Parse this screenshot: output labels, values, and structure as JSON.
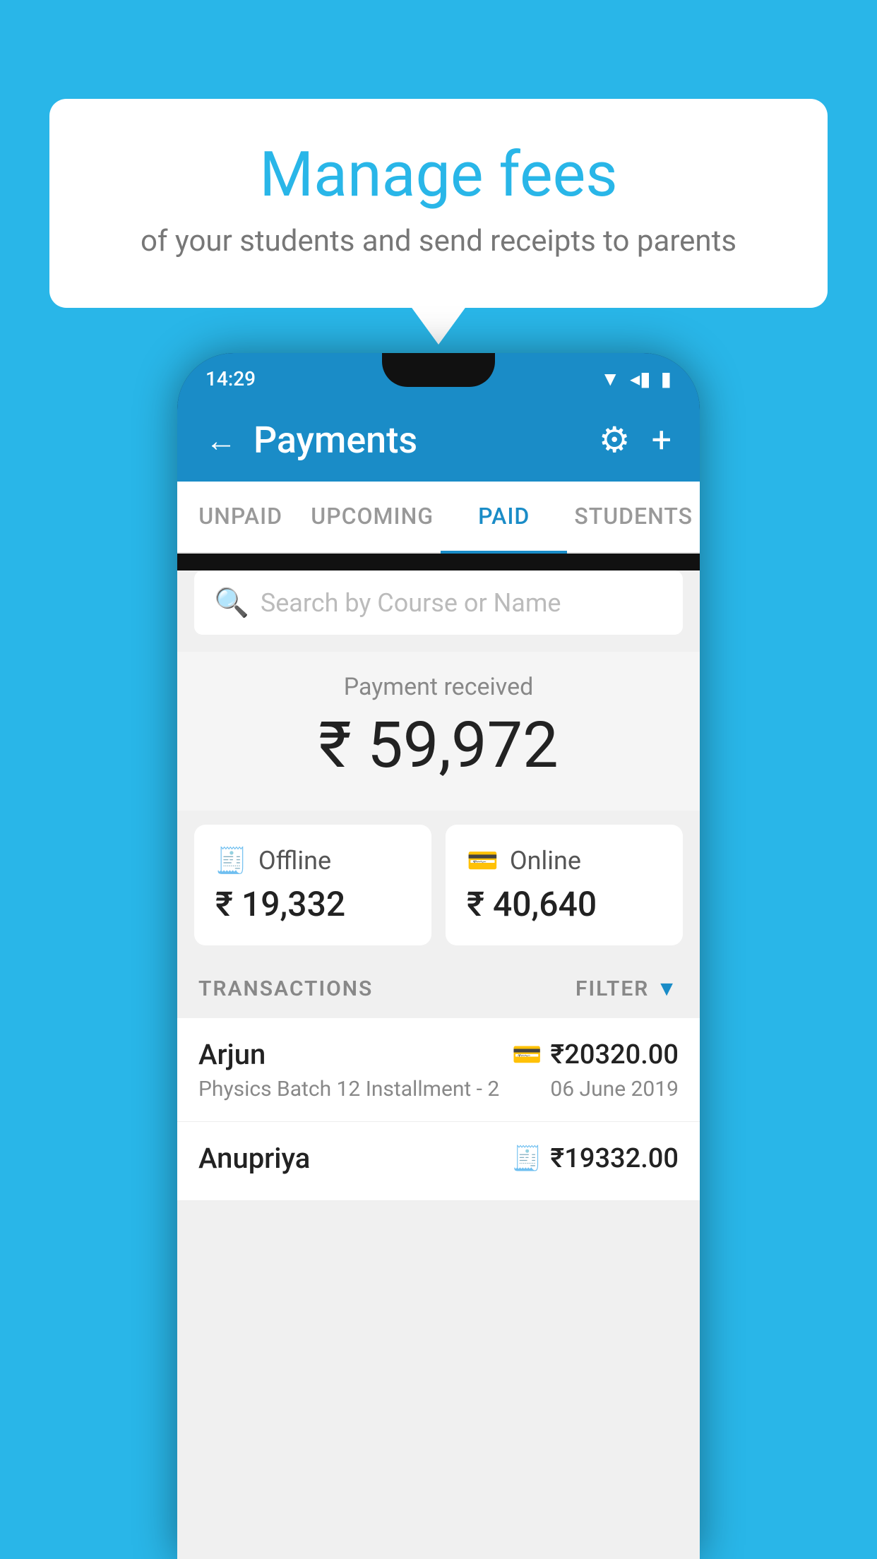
{
  "background_color": "#29b6e8",
  "speech_bubble": {
    "title": "Manage fees",
    "subtitle": "of your students and send receipts to parents"
  },
  "status_bar": {
    "time": "14:29",
    "wifi": "▼",
    "signal": "◂",
    "battery": "▮"
  },
  "header": {
    "title": "Payments",
    "back_label": "←",
    "gear_label": "⚙",
    "plus_label": "+"
  },
  "tabs": [
    {
      "label": "UNPAID",
      "active": false
    },
    {
      "label": "UPCOMING",
      "active": false
    },
    {
      "label": "PAID",
      "active": true
    },
    {
      "label": "STUDENTS",
      "active": false
    }
  ],
  "search": {
    "placeholder": "Search by Course or Name"
  },
  "payment_summary": {
    "label": "Payment received",
    "amount": "₹ 59,972"
  },
  "payment_cards": [
    {
      "type": "Offline",
      "amount": "₹ 19,332",
      "icon": "💳"
    },
    {
      "type": "Online",
      "amount": "₹ 40,640",
      "icon": "💳"
    }
  ],
  "transactions_label": "TRANSACTIONS",
  "filter_label": "FILTER",
  "transactions": [
    {
      "name": "Arjun",
      "course": "Physics Batch 12 Installment - 2",
      "amount": "₹20320.00",
      "date": "06 June 2019",
      "mode": "online"
    },
    {
      "name": "Anupriya",
      "course": "",
      "amount": "₹19332.00",
      "date": "",
      "mode": "offline"
    }
  ]
}
